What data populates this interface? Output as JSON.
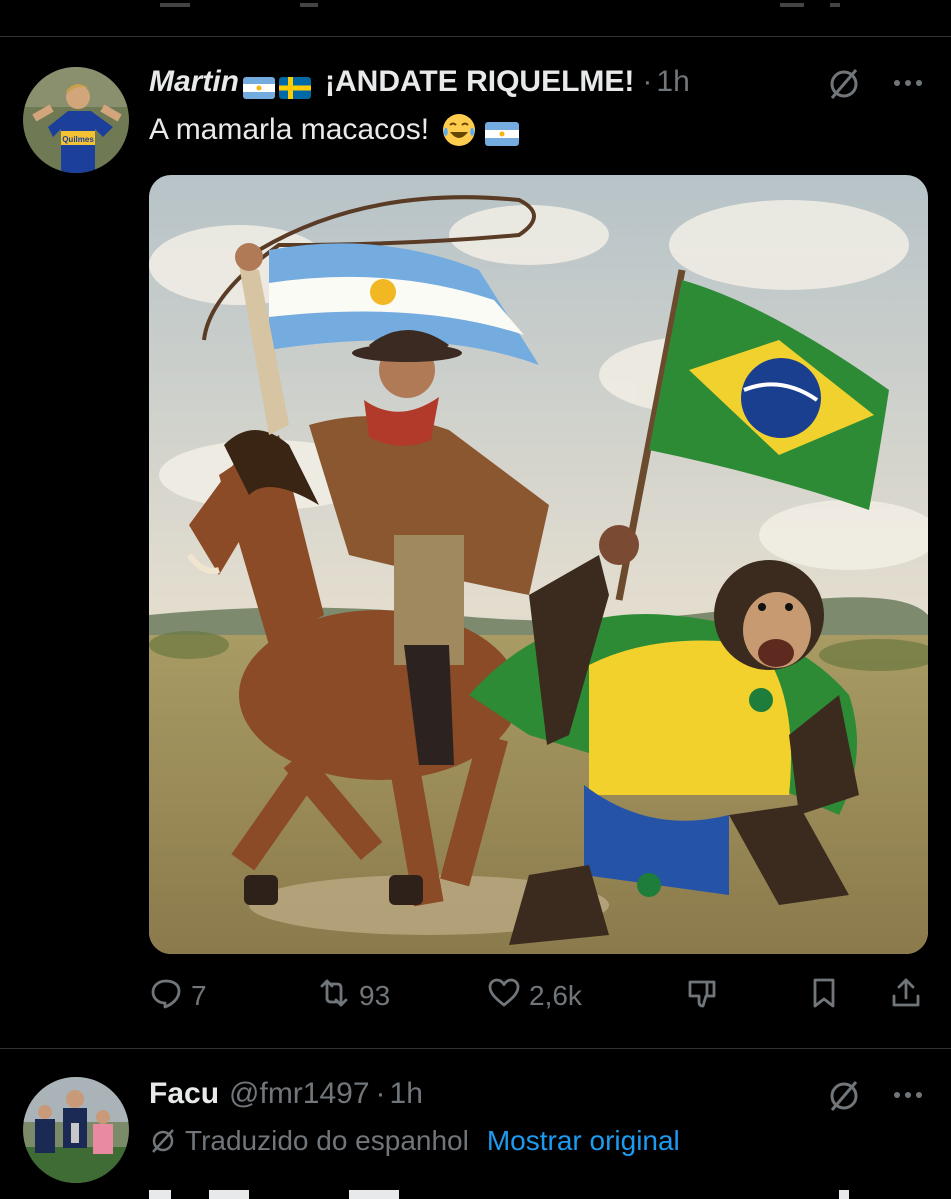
{
  "tweet1": {
    "author_name": "Martin",
    "author_flags": [
      "argentina-flag",
      "sweden-flag"
    ],
    "display_suffix": "¡ANDATE RIQUELME!",
    "separator": "·",
    "time": "1h",
    "text": "A mamarla macacos!",
    "text_emojis": [
      "laughing-tears-emoji",
      "argentina-flag"
    ],
    "image_alt": "Painting of an Argentine gaucho on horseback holding an Argentine flag chasing a chimpanzee in a Brazil jersey carrying a Brazilian flag",
    "actions": {
      "replies": "7",
      "reposts": "93",
      "likes": "2,6k"
    }
  },
  "tweet2": {
    "author_name": "Facu",
    "handle": "@fmr1497",
    "separator": "·",
    "time": "1h",
    "translated_label": "Traduzido do espanhol",
    "show_original_label": "Mostrar original"
  },
  "colors": {
    "background": "#000000",
    "text_primary": "#e7e9ea",
    "text_secondary": "#71767b",
    "link": "#1d9bf0",
    "divider": "#2f3336"
  }
}
